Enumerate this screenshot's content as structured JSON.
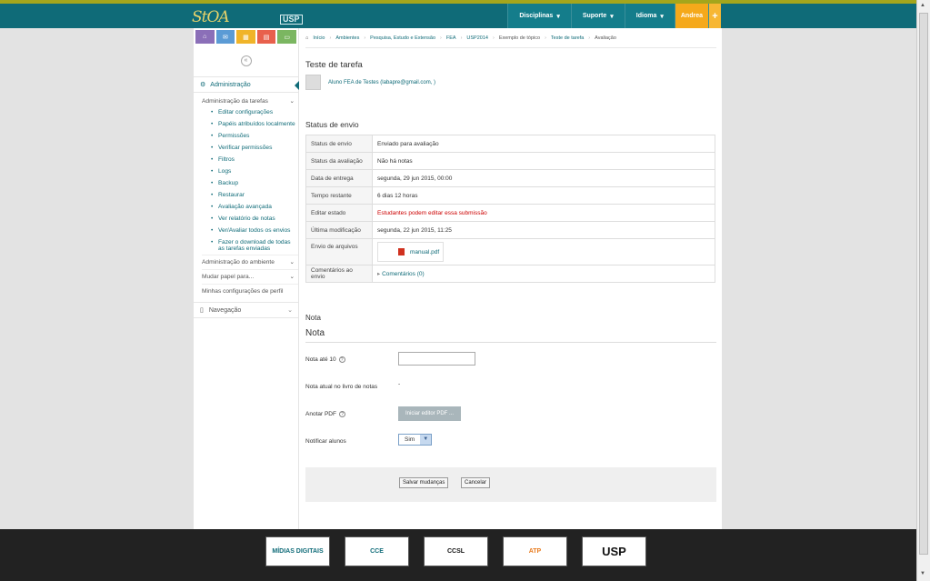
{
  "header": {
    "logo": "StOA",
    "usp_mark": "USP",
    "nav": [
      "Disciplinas",
      "Suporte",
      "Idioma"
    ],
    "user": "Andrea",
    "plus": "+"
  },
  "sidebar": {
    "collapse_symbol": "«",
    "block_title": "Administração",
    "group1": "Administração da tarefas",
    "items": [
      "Editar configurações",
      "Papéis atribuídos localmente",
      "Permissões",
      "Verificar permissões",
      "Filtros",
      "Logs",
      "Backup",
      "Restaurar",
      "Avaliação avançada",
      "Ver relatório de notas",
      "Ver/Avaliar todos os envios",
      "Fazer o download de todas as tarefas enviadas"
    ],
    "group2": "Administração do ambiente",
    "group3": "Mudar papel para...",
    "group4": "Minhas configurações de perfil",
    "nav_block": "Navegação"
  },
  "breadcrumb": [
    "Início",
    "Ambientes",
    "Pesquisa, Estudo e Extensão",
    "FEA",
    "USP2014",
    "Exemplo de tópico",
    "Teste de tarefa",
    "Avaliação"
  ],
  "main": {
    "title": "Teste de tarefa",
    "author": "Aluno FEA de Testes (labapre@gmail.com, )",
    "status_heading": "Status de envio",
    "status": [
      {
        "k": "Status de envio",
        "v": "Enviado para avaliação"
      },
      {
        "k": "Status da avaliação",
        "v": "Não há notas"
      },
      {
        "k": "Data de entrega",
        "v": "segunda, 29 jun 2015, 00:00"
      },
      {
        "k": "Tempo restante",
        "v": "6 dias 12 horas"
      },
      {
        "k": "Editar estado",
        "v": "Estudantes podem editar essa submissão"
      },
      {
        "k": "Última modificação",
        "v": "segunda, 22 jun 2015, 11:25"
      },
      {
        "k": "Envio de arquivos",
        "v": "manual.pdf"
      },
      {
        "k": "Comentários ao envio",
        "v": "Comentários (0)"
      }
    ],
    "grade_small": "Nota",
    "grade_big": "Nota",
    "grade_label": "Nota até 10",
    "current_label": "Nota atual no livro de notas",
    "current_value": "-",
    "annotate_label": "Anotar PDF",
    "annotate_button": "Iniciar editor PDF ...",
    "notify_label": "Notificar alunos",
    "notify_value": "Sim",
    "save": "Salvar mudanças",
    "cancel": "Cancelar"
  },
  "footer_logos": [
    "MÍDIAS DIGITAIS",
    "CCE",
    "CCSL",
    "ATP",
    "USP"
  ],
  "colors": {
    "teal": "#0f6b78",
    "orange": "#f5a91b",
    "red": "#cc0000"
  }
}
